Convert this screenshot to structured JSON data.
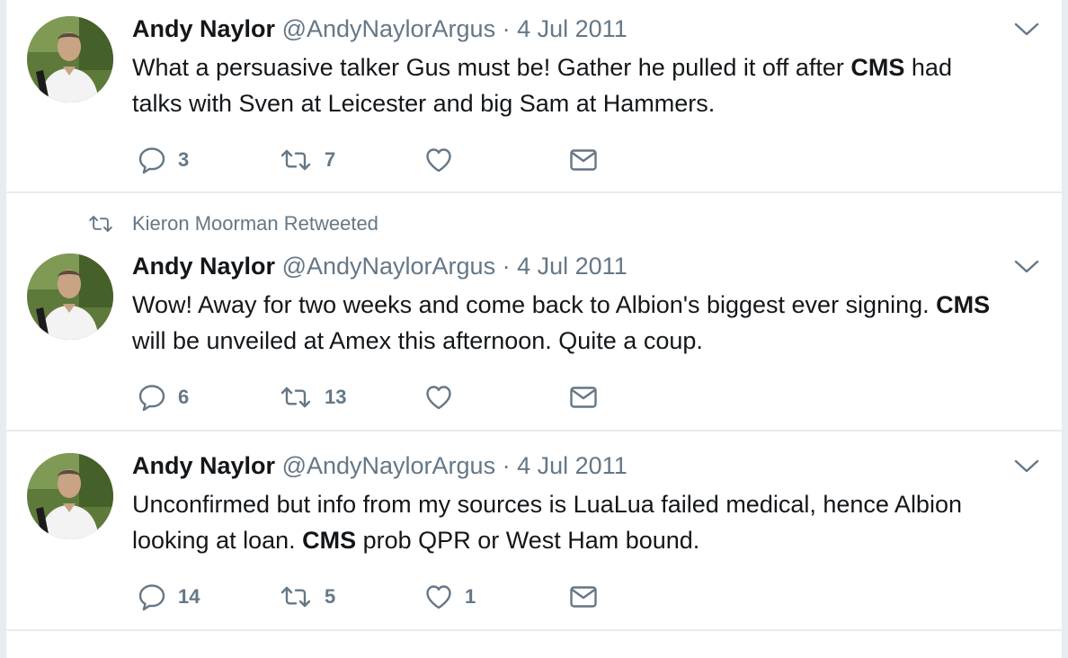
{
  "retweet_context": {
    "label": "Kieron Moorman Retweeted",
    "icon": "retweet-icon"
  },
  "tweets": [
    {
      "author": {
        "name": "Andy Naylor",
        "handle": "@AndyNaylorArgus"
      },
      "separator": "·",
      "date": "4 Jul 2011",
      "text_parts": [
        "What a persuasive talker Gus must be! Gather he pulled it off after ",
        "CMS",
        " had",
        "talks with Sven at Leicester and big Sam at Hammers."
      ],
      "replies": "3",
      "retweets": "7",
      "likes": ""
    },
    {
      "author": {
        "name": "Andy Naylor",
        "handle": "@AndyNaylorArgus"
      },
      "separator": "·",
      "date": "4 Jul 2011",
      "text_parts": [
        "Wow! Away for two weeks and come back to Albion's biggest ever signing. ",
        "CMS",
        "will be unveiled at Amex this afternoon. Quite a coup."
      ],
      "replies": "6",
      "retweets": "13",
      "likes": ""
    },
    {
      "author": {
        "name": "Andy Naylor",
        "handle": "@AndyNaylorArgus"
      },
      "separator": "·",
      "date": "4 Jul 2011",
      "text_parts": [
        "Unconfirmed but info from my sources is LuaLua failed medical, hence Albion",
        "looking at loan. ",
        "CMS",
        " prob QPR or West Ham bound."
      ],
      "replies": "14",
      "retweets": "5",
      "likes": "1"
    }
  ],
  "icons": [
    "reply-icon",
    "retweet-icon",
    "like-icon",
    "dm-icon",
    "chevron-down-icon"
  ],
  "colors": {
    "text": "#14171a",
    "secondary": "#657786",
    "border": "#e6ecf0",
    "background": "#ffffff"
  }
}
